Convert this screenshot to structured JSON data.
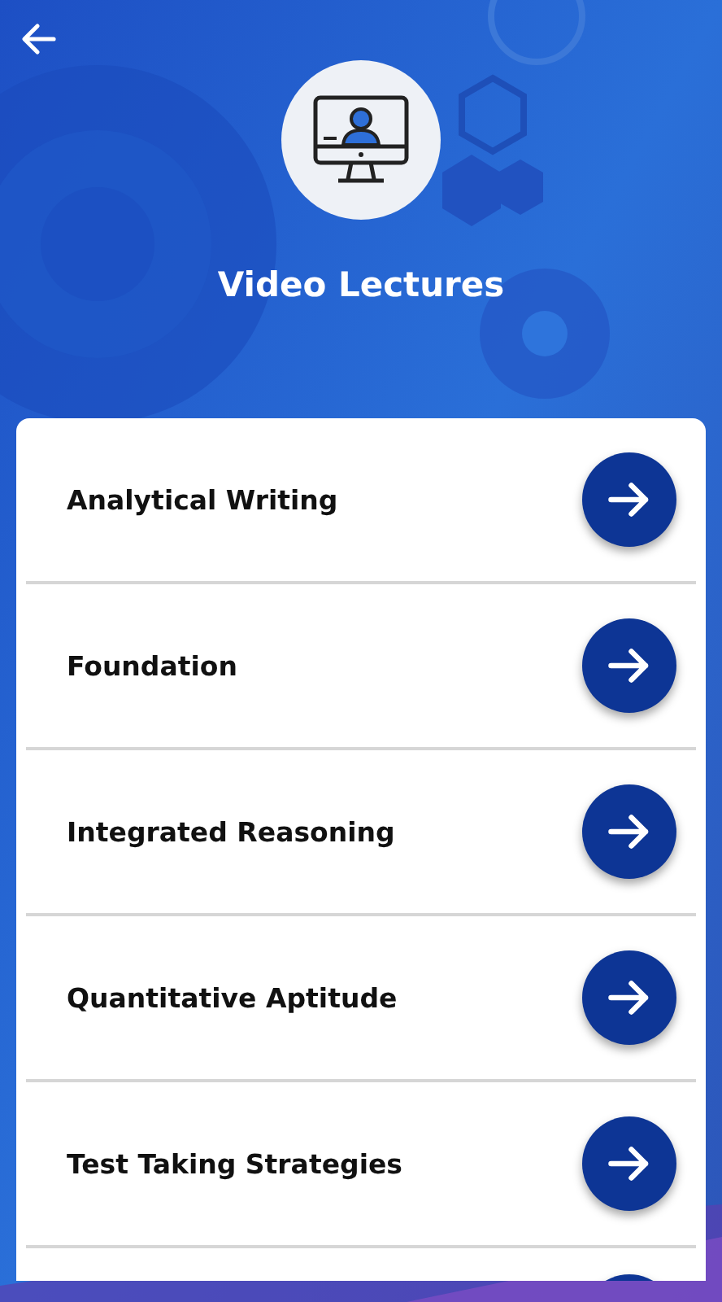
{
  "header": {
    "title": "Video Lectures"
  },
  "items": [
    {
      "kind": "row",
      "label": "Analytical Writing"
    },
    {
      "kind": "row",
      "label": "Foundation"
    },
    {
      "kind": "row",
      "label": "Integrated Reasoning"
    },
    {
      "kind": "row",
      "label": "Quantitative Aptitude"
    },
    {
      "kind": "row",
      "label": "Test Taking Strategies"
    },
    {
      "kind": "cut"
    }
  ]
}
